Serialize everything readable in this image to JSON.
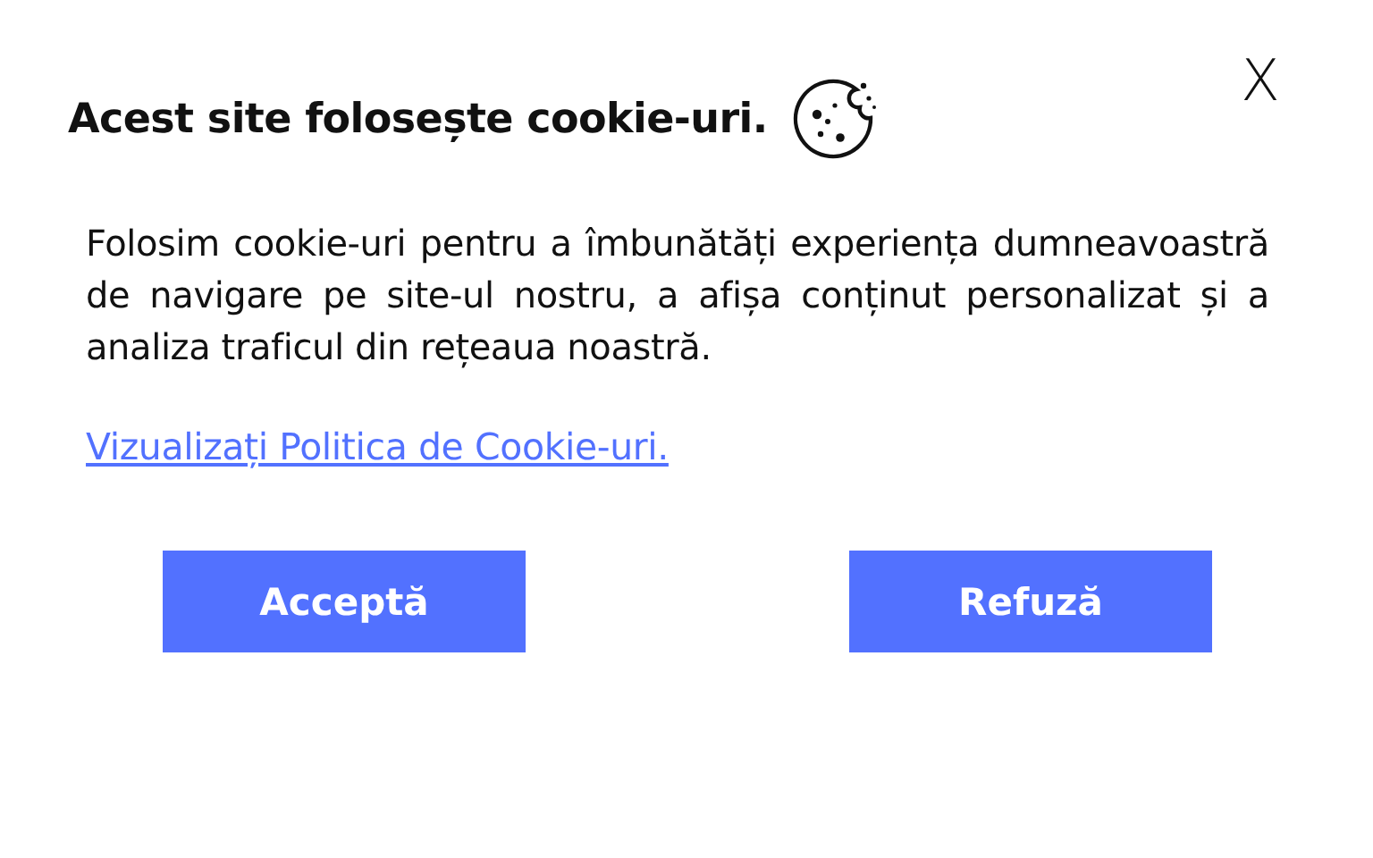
{
  "close": {
    "label": "X"
  },
  "title": "Acest site folosește cookie-uri.",
  "message": "Folosim cookie-uri pentru a îmbunătăți experiența dumneavoastră de navigare pe site-ul nostru, a afișa conținut personalizat și a analiza traficul din rețeaua noastră.",
  "policy_link": "Vizualizați Politica de Cookie-uri.",
  "buttons": [
    "Acceptă",
    "Refuză"
  ]
}
